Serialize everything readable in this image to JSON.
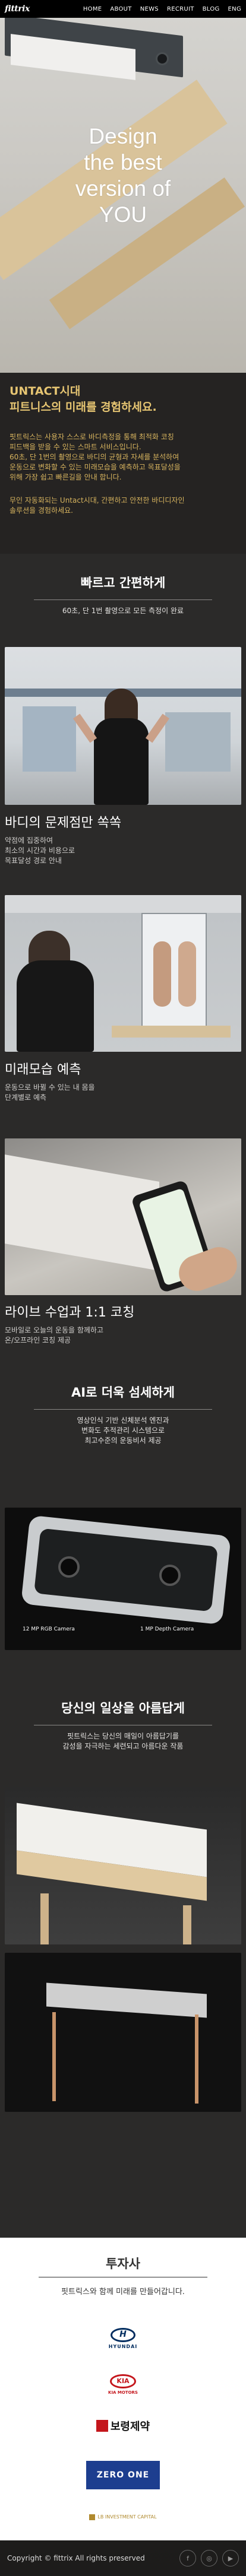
{
  "nav": {
    "logo": "fittrix",
    "items": [
      "HOME",
      "ABOUT",
      "NEWS",
      "RECRUIT",
      "BLOG",
      "ENG"
    ]
  },
  "hero": {
    "title": "Design\nthe best\nversion of\nYOU"
  },
  "intro": {
    "heading_1": "UNTACT시대",
    "heading_2": "피트니스의 미래를 경험하세요.",
    "body_1": "핏트릭스는 사용자 스스로 바디측정을 통해 최적화 코칭\n피드백을 받을 수 있는 스마트 서비스입니다.\n60초, 단 1번의 촬영으로 바디의 균형과 자세를 분석하여\n운동으로 변화할 수 있는 미래모습을 예측하고 목표달성을\n위해 가장 쉽고 빠른길을 안내 합니다.",
    "body_2": "무인 자동화되는 Untact시대, 간편하고 안전한 바디디자인\n솔루션을 경험하세요."
  },
  "section_fast": {
    "title": "빠르고 간편하게",
    "subtitle": "60초, 단 1번 촬영으로 모든 측정이 완료"
  },
  "feature_1": {
    "title": "바디의 문제점만 쏙쏙",
    "desc": "약점에 집중하여\n최소의 시간과 비용으로\n목표달성 경로 안내"
  },
  "feature_2": {
    "title": "미래모습 예측",
    "desc": "운동으로 바뀔 수 있는 내 몸을\n단계별로 예측"
  },
  "feature_3": {
    "title": "라이브 수업과 1:1 코칭",
    "desc": "모바일로 오늘의 운동을 함께하고\n온/오프라인 코칭 제공"
  },
  "section_ai": {
    "title": "AI로 더욱 섬세하게",
    "subtitle": "영상인식 기반 신체분석 엔진과\n변화도 추적관리 시스템으로\n최고수준의 운동비서 제공",
    "camera_label_1": "12 MP RGB Camera",
    "camera_label_2": "1 MP Depth Camera"
  },
  "section_life": {
    "title": "당신의 일상을 아름답게",
    "subtitle": "핏트릭스는 당신의 매일이 아름답기를\n감성을 자극하는 세련되고 아름다운 작품"
  },
  "investor": {
    "title": "투자사",
    "subtitle": "핏트릭스와 함께 미래를 만들어갑니다.",
    "partners": [
      {
        "name": "HYUNDAI",
        "color": "#002c5f"
      },
      {
        "name": "KIA MOTORS",
        "color": "#c4161c"
      },
      {
        "name": "보령제약",
        "color": "#111111"
      },
      {
        "name": "ZERO ONE",
        "color": "#1d3e8f"
      },
      {
        "name": "LB INVESTMENT CAPITAL",
        "color": "#b08a2e"
      }
    ]
  },
  "footer": {
    "copyright": "Copyright © fittrix All rights preserved",
    "socials": [
      "facebook-icon",
      "instagram-icon",
      "youtube-icon"
    ]
  }
}
